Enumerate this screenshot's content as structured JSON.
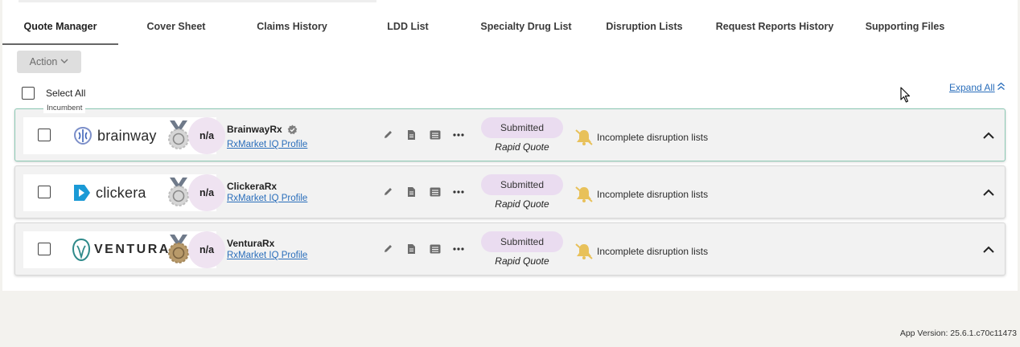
{
  "tabs": [
    {
      "label": "Quote Manager",
      "active": true
    },
    {
      "label": "Cover Sheet"
    },
    {
      "label": "Claims History"
    },
    {
      "label": "LDD List"
    },
    {
      "label": "Specialty Drug List"
    },
    {
      "label": "Disruption Lists"
    },
    {
      "label": "Request Reports History"
    },
    {
      "label": "Supporting Files"
    }
  ],
  "toolbar": {
    "action_label": "Action"
  },
  "list": {
    "select_all_label": "Select All",
    "expand_all_label": "Expand All",
    "incumbent_label": "Incumbent"
  },
  "vendors": [
    {
      "logo_text": "brainway",
      "rating": "n/a",
      "name": "BrainwayRx",
      "profile_link": "RxMarket IQ Profile",
      "status": "Submitted",
      "quote_type": "Rapid Quote",
      "warning": "Incomplete disruption lists",
      "medal": "silver",
      "incumbent": true
    },
    {
      "logo_text": "clickera",
      "rating": "n/a",
      "name": "ClickeraRx",
      "profile_link": "RxMarket IQ Profile",
      "status": "Submitted",
      "quote_type": "Rapid Quote",
      "warning": "Incomplete disruption lists",
      "medal": "silver"
    },
    {
      "logo_text": "VENTURA",
      "rating": "n/a",
      "name": "VenturaRx",
      "profile_link": "RxMarket IQ Profile",
      "status": "Submitted",
      "quote_type": "Rapid Quote",
      "warning": "Incomplete disruption lists",
      "medal": "bronze"
    }
  ],
  "footer": {
    "version": "App Version: 25.6.1.c70c11473"
  },
  "colors": {
    "accent_link": "#2a6ebb",
    "status_pill": "#eadcf0",
    "rating_circle": "#efe3f1",
    "incumbent_border": "#8cc9b4",
    "warning_icon": "#e8c15a"
  },
  "icons": [
    "verified-badge-icon",
    "edit-icon",
    "document-icon",
    "list-icon",
    "more-icon",
    "bell-off-icon",
    "chevron-up-icon",
    "chevron-down-icon",
    "double-chevron-up-icon",
    "checkbox-icon",
    "medal-icon"
  ]
}
